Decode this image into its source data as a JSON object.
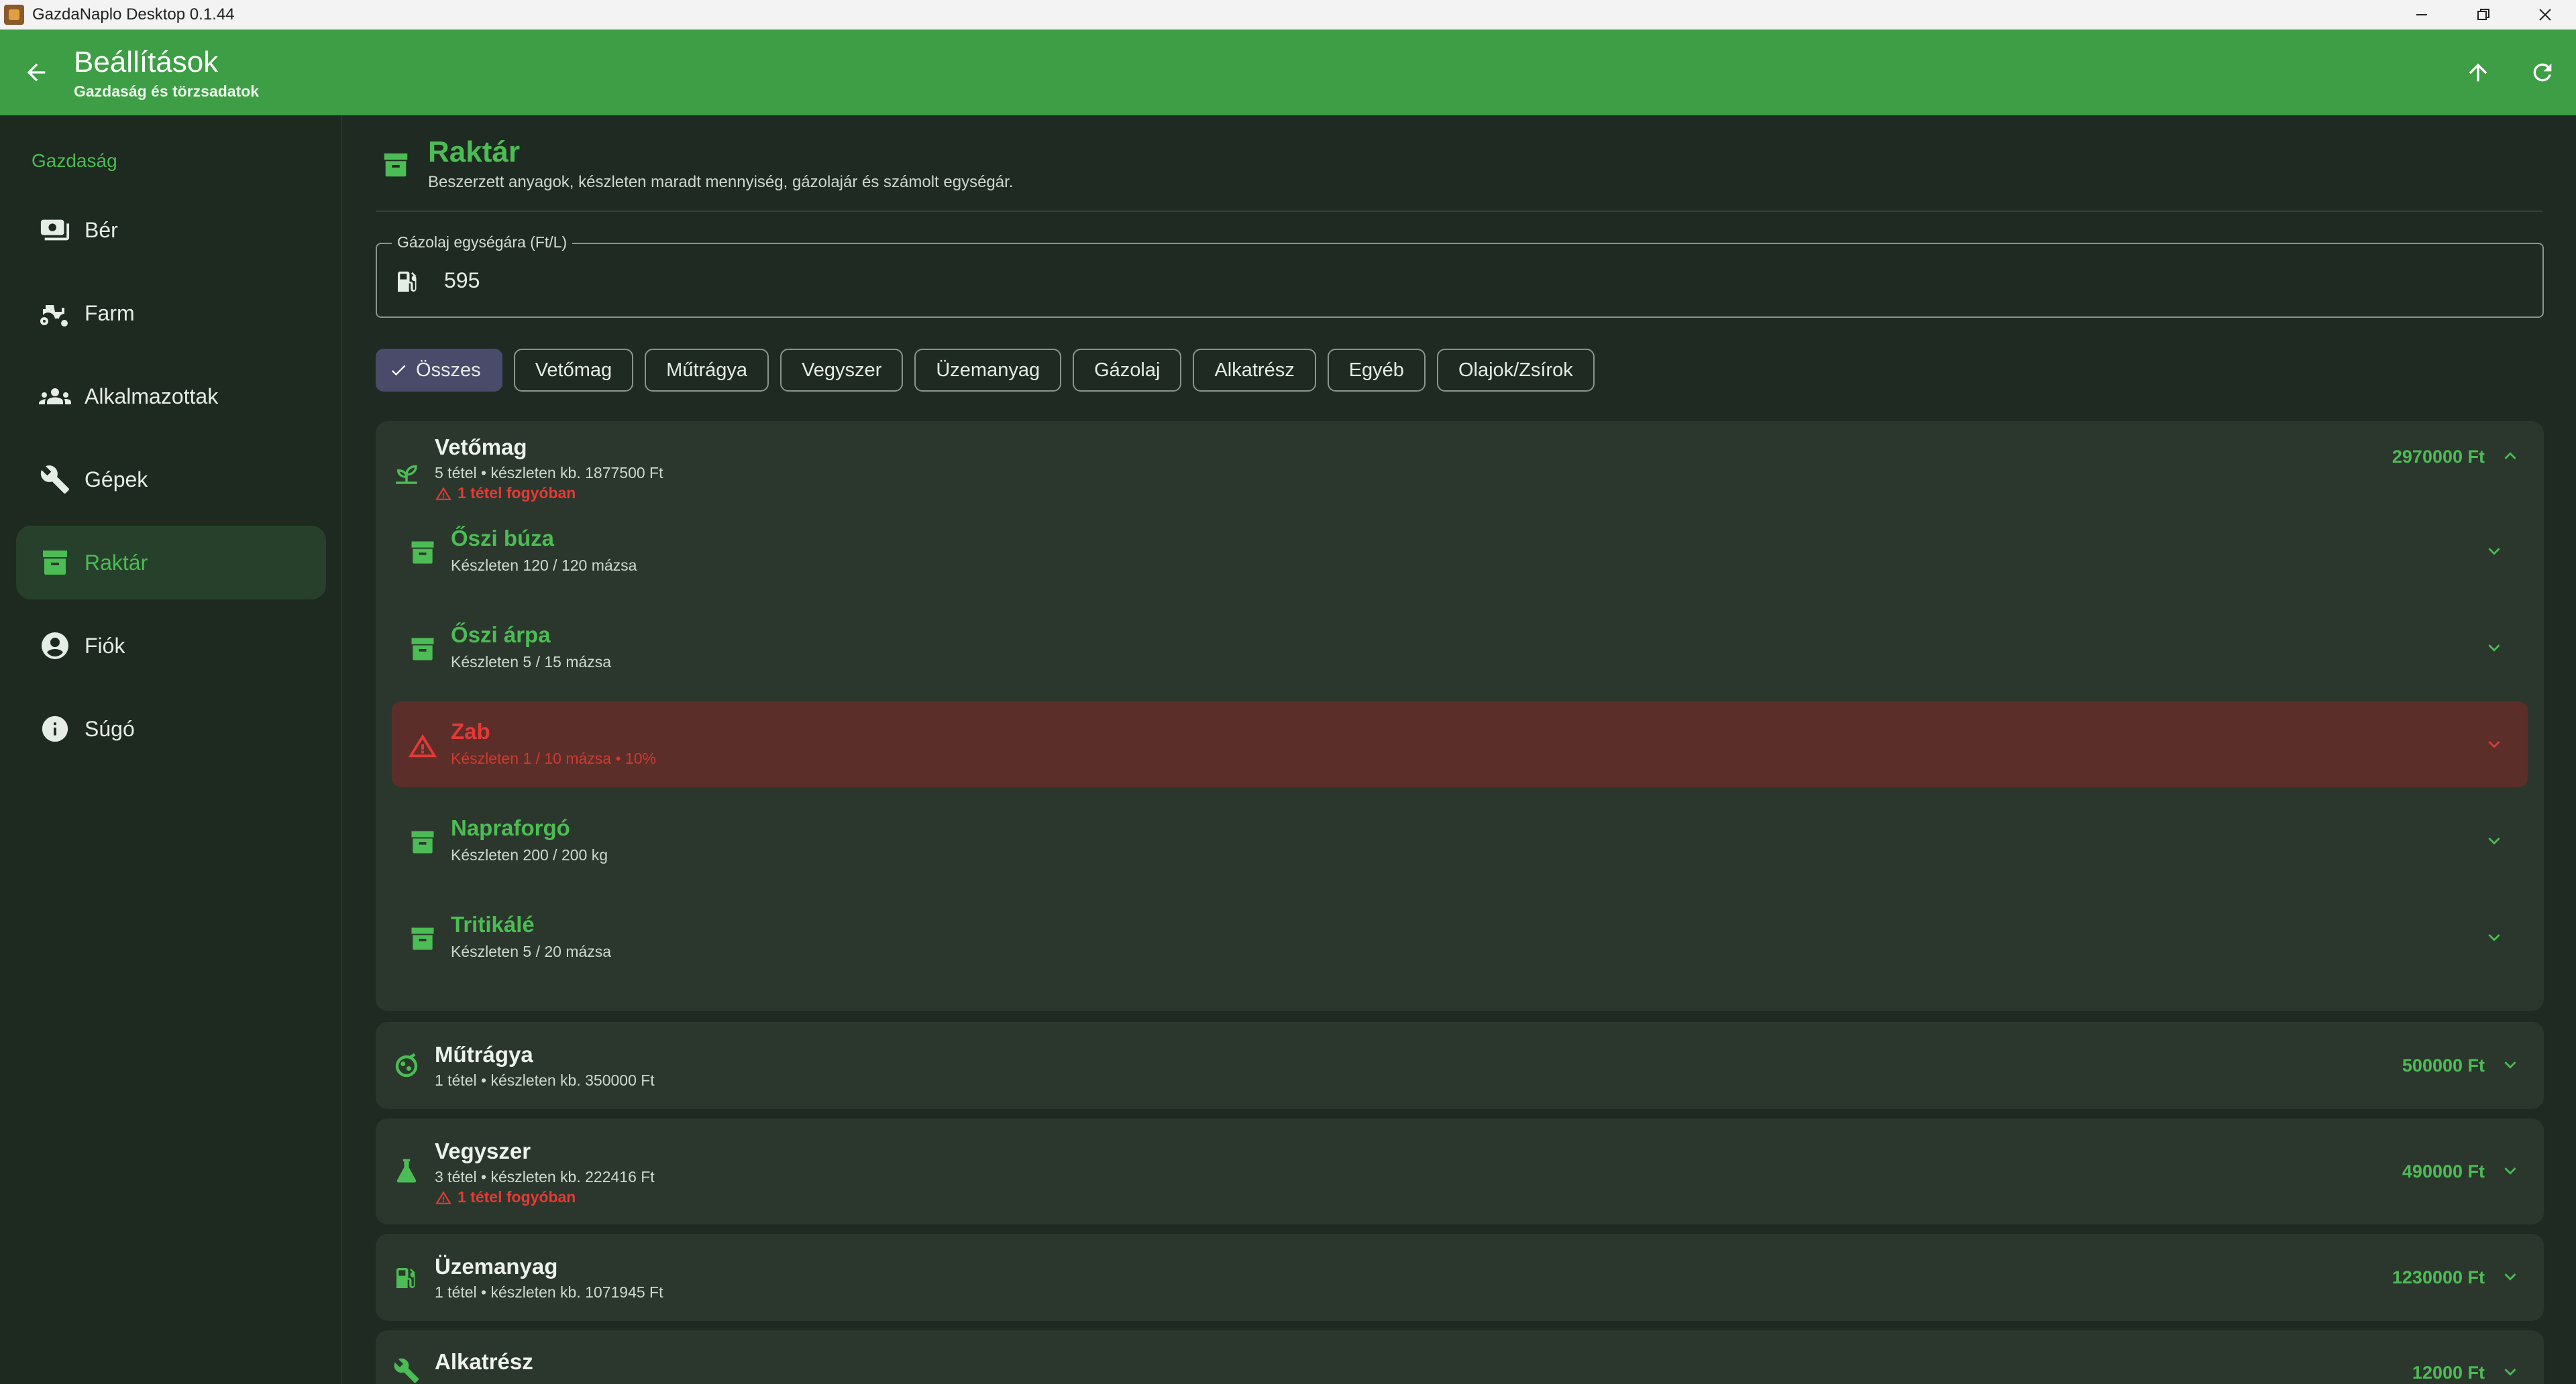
{
  "window": {
    "title": "GazdaNaplo Desktop 0.1.44"
  },
  "appbar": {
    "title": "Beállítások",
    "subtitle": "Gazdaság és törzsadatok"
  },
  "sidebar": {
    "section": "Gazdaság",
    "items": [
      {
        "label": "Bér",
        "icon": "payments-icon"
      },
      {
        "label": "Farm",
        "icon": "tractor-icon"
      },
      {
        "label": "Alkalmazottak",
        "icon": "people-icon"
      },
      {
        "label": "Gépek",
        "icon": "wrench-icon"
      },
      {
        "label": "Raktár",
        "icon": "archive-box-icon",
        "active": true
      },
      {
        "label": "Fiók",
        "icon": "account-circle-icon"
      },
      {
        "label": "Súgó",
        "icon": "info-icon"
      }
    ]
  },
  "page": {
    "title": "Raktár",
    "subtitle": "Beszerzett anyagok, készleten maradt mennyiség, gázolajár és számolt egységár."
  },
  "diesel_field": {
    "label": "Gázolaj egységára (Ft/L)",
    "value": "595"
  },
  "filters": {
    "selected": "Összes",
    "chips": [
      "Összes",
      "Vetőmag",
      "Műtrágya",
      "Vegyszer",
      "Üzemanyag",
      "Gázolaj",
      "Alkatrész",
      "Egyéb",
      "Olajok/Zsírok"
    ]
  },
  "categories": [
    {
      "name": "Vetőmag",
      "summary": "5 tétel • készleten kb. 1877500 Ft",
      "warning": "1 tétel fogyóban",
      "price": "2970000 Ft",
      "expanded": true,
      "items": [
        {
          "name": "Őszi búza",
          "detail": "Készleten 120 / 120 mázsa",
          "low": false
        },
        {
          "name": "Őszi árpa",
          "detail": "Készleten 5 / 15 mázsa",
          "low": false
        },
        {
          "name": "Zab",
          "detail": "Készleten 1 / 10 mázsa • 10%",
          "low": true
        },
        {
          "name": "Napraforgó",
          "detail": "Készleten 200 / 200 kg",
          "low": false
        },
        {
          "name": "Tritikálé",
          "detail": "Készleten 5 / 20 mázsa",
          "low": false
        }
      ]
    },
    {
      "name": "Műtrágya",
      "summary": "1 tétel • készleten kb. 350000 Ft",
      "price": "500000 Ft",
      "expanded": false
    },
    {
      "name": "Vegyszer",
      "summary": "3 tétel • készleten kb. 222416 Ft",
      "warning": "1 tétel fogyóban",
      "price": "490000 Ft",
      "expanded": false
    },
    {
      "name": "Üzemanyag",
      "summary": "1 tétel • készleten kb. 1071945 Ft",
      "price": "1230000 Ft",
      "expanded": false
    },
    {
      "name": "Alkatrész",
      "price": "12000 Ft",
      "expanded": false
    }
  ],
  "colors": {
    "accent": "#3e9e45",
    "accent_text": "#4cbc54",
    "warning": "#e53935",
    "selected_chip": "#4a4a6a"
  }
}
